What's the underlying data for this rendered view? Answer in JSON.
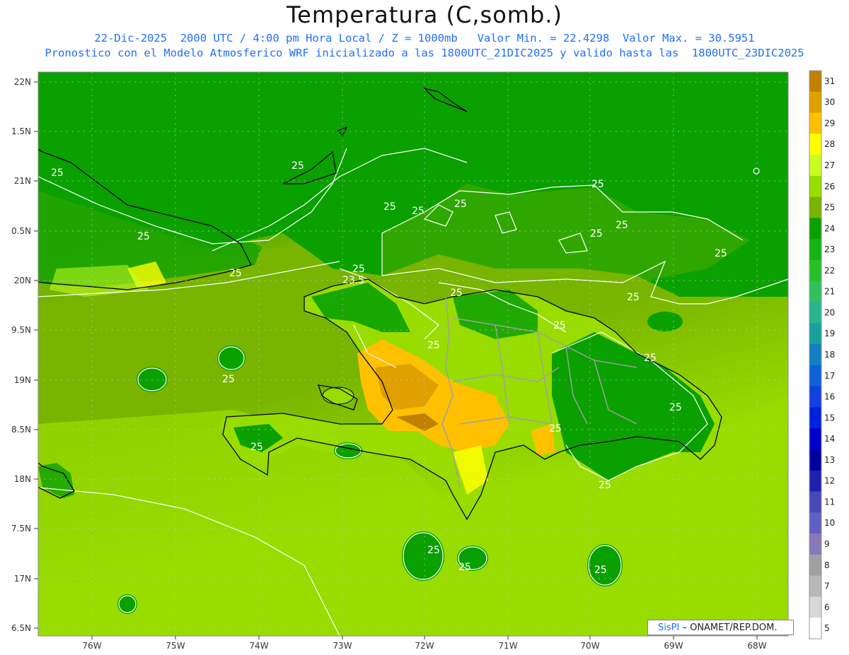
{
  "header": {
    "title": "Temperatura (C,somb.)",
    "line1": "22-Dic-2025  2000 UTC / 4:00 pm Hora Local / Z = 1000mb   Valor Min. = 22.4298  Valor Max. = 30.5951",
    "line2": "Pronostico con el Modelo Atmosferico WRF inicializado a las 1800UTC_21DIC2025 y valido hasta las  1800UTC_23DIC2025"
  },
  "axes": {
    "lat_labels": [
      "22N",
      "1.5N",
      "21N",
      "0.5N",
      "20N",
      "9.5N",
      "19N",
      "8.5N",
      "18N",
      "7.5N",
      "17N",
      "6.5N"
    ],
    "lon_labels": [
      "76W",
      "75W",
      "74W",
      "73W",
      "72W",
      "71W",
      "70W",
      "69W",
      "68W"
    ]
  },
  "legend": {
    "labels": [
      "31",
      "30",
      "29",
      "28",
      "27",
      "26",
      "25",
      "24",
      "23",
      "22",
      "21",
      "20",
      "19",
      "18",
      "17",
      "16",
      "15",
      "14",
      "13",
      "12",
      "11",
      "10",
      "9",
      "8",
      "7",
      "6",
      "5"
    ],
    "colors": [
      "#c08000",
      "#e0a000",
      "#ffc000",
      "#ffff00",
      "#c8ff20",
      "#98dc00",
      "#78b400",
      "#0aa000",
      "#14b414",
      "#28c028",
      "#30c060",
      "#28b48c",
      "#18a0a0",
      "#1080c0",
      "#1060d8",
      "#1040e0",
      "#0020e0",
      "#0000c8",
      "#0000a0",
      "#2020b0",
      "#4848b8",
      "#6060c0",
      "#8878b8",
      "#a0a0a0",
      "#b8b8b8",
      "#d8d8d8",
      "#ffffff"
    ]
  },
  "contours": {
    "labels": [
      "25",
      "25",
      "25",
      "25",
      "25",
      "25",
      "25",
      "25",
      "25",
      "25",
      "25",
      "25",
      "23.5",
      "25",
      "25",
      "25",
      "25",
      "25",
      "25",
      "25",
      "25",
      "25",
      "25",
      "25",
      "25",
      "25",
      "25",
      "25"
    ]
  },
  "credit": {
    "brand": "SisPI",
    "text": "– ONAMET/REP.DOM."
  }
}
